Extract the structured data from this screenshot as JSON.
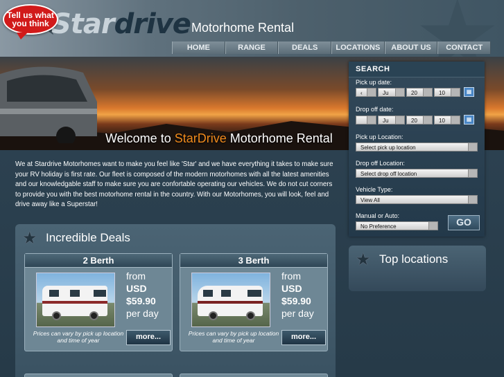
{
  "header": {
    "feedback_bubble": "Tell us what you think",
    "logo_part1": "Star",
    "logo_part2": "drive",
    "tagline": "Motorhome Rental"
  },
  "nav": [
    {
      "label": "HOME"
    },
    {
      "label": "RANGE"
    },
    {
      "label": "DEALS"
    },
    {
      "label": "LOCATIONS"
    },
    {
      "label": "ABOUT US"
    },
    {
      "label": "CONTACT"
    }
  ],
  "hero": {
    "welcome_prefix": "Welcome to ",
    "welcome_brand": "StarDrive",
    "welcome_suffix": " Motorhome Rental"
  },
  "search": {
    "title": "SEARCH",
    "pickup_date_label": "Pick up date:",
    "pickup_date": {
      "day": "‹",
      "month": "Ju",
      "hour": "20",
      "minute": "10"
    },
    "dropoff_date_label": "Drop off date:",
    "dropoff_date": {
      "day": "",
      "month": "Ju",
      "hour": "20",
      "minute": "10"
    },
    "pickup_location_label": "Pick up Location:",
    "pickup_location_value": "Select pick up location",
    "dropoff_location_label": "Drop off Location:",
    "dropoff_location_value": "Select drop off location",
    "vehicle_type_label": "Vehicle Type:",
    "vehicle_type_value": "View All",
    "transmission_label": "Manual or Auto:",
    "transmission_value": "No Preference",
    "go_label": "GO",
    "calendar_icon": "calendar-icon"
  },
  "intro_text": "We at Stardrive Motorhomes want to make you feel like 'Star' and we have everything it takes to make sure your RV holiday is first rate. Our fleet is composed of the modern motorhomes with all the latest amenities and our knowledgable staff to make sure you are confortable operating our vehicles. We do not cut corners to provide you with the best motorhome rental in the country. With our Motorhomes, you will look, feel and drive away like a Superstar!",
  "deals": {
    "title": "Incredible Deals",
    "items": [
      {
        "name": "2 Berth",
        "from": "from",
        "currency": "USD",
        "price": "$59.90",
        "per": "per day",
        "note": "Prices can vary by pick up location and time of year",
        "more": "more..."
      },
      {
        "name": "3 Berth",
        "from": "from",
        "currency": "USD",
        "price": "$59.90",
        "per": "per day",
        "note": "Prices can vary by pick up location and time of year",
        "more": "more..."
      }
    ]
  },
  "top_locations": {
    "title": "Top locations"
  },
  "colors": {
    "accent_orange": "#f08a1c",
    "bubble_red": "#d11a1a",
    "calendar_blue": "#4a87c6"
  }
}
